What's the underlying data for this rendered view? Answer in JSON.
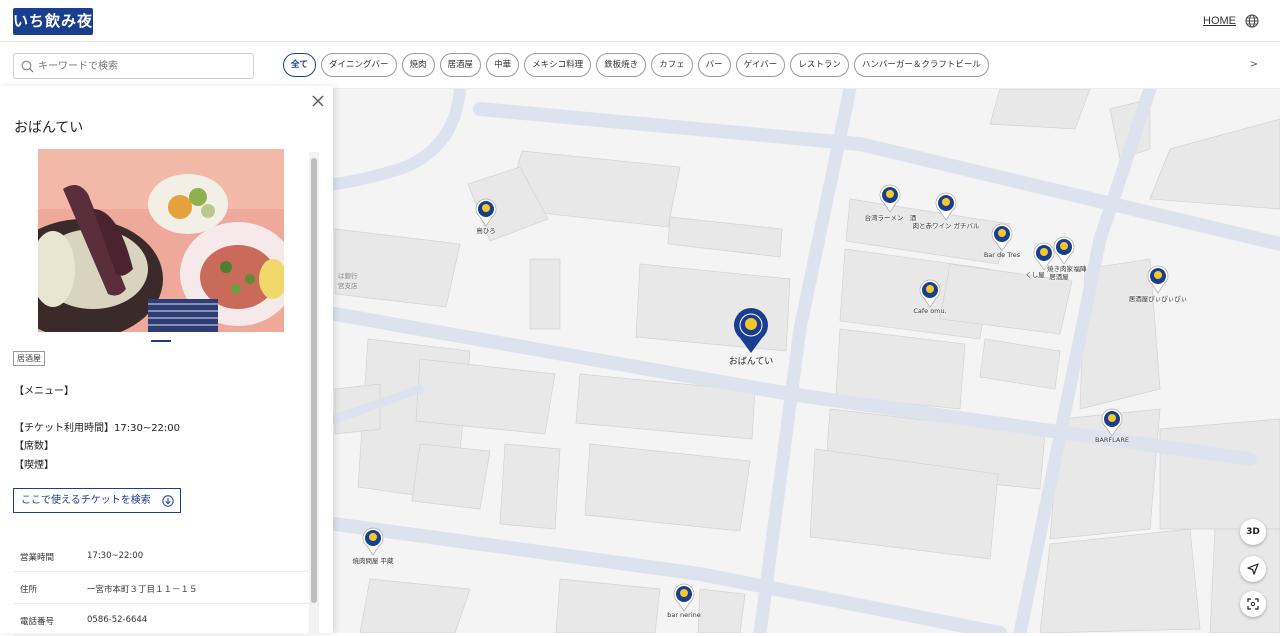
{
  "header": {
    "logo_text": "いち飲み夜",
    "home_label": "HOME",
    "globe_icon": "globe-icon"
  },
  "search": {
    "placeholder": "キーワードで検索"
  },
  "categories": [
    "全て",
    "ダイニングバー",
    "焼肉",
    "居酒屋",
    "中華",
    "メキシコ料理",
    "鉄板焼き",
    "カフェ",
    "バー",
    "ゲイバー",
    "レストラン",
    "ハンバーガー＆クラフトビール"
  ],
  "active_category": "全て",
  "next_arrow": ">",
  "panel": {
    "title": "おばんてい",
    "category_tag": "居酒屋",
    "menu_label": "【メニュー】",
    "ticket_time": "【チケット利用時間】17:30~22:00",
    "seats": "【席数】",
    "smoking": "【喫煙】",
    "ticket_button": "ここで使えるチケットを検索",
    "details": [
      {
        "key": "営業時間",
        "value": "17:30~22:00"
      },
      {
        "key": "住所",
        "value": "一宮市本町３丁目１１－１５"
      },
      {
        "key": "電話番号",
        "value": "0586-52-6644"
      }
    ]
  },
  "map": {
    "selected_label": "おばんてい",
    "pin_labels": [
      "鳥ひろ",
      "台湾ラーメン",
      "酒",
      "肉と赤ワイン ガチバル",
      "Bar de Tres",
      "くし屋",
      "焼き肉家",
      "居酒屋",
      "福陣",
      "居酒屋ぴぃぴぃぴぃ",
      "Cafe omu.",
      "BARFLARE",
      "焼肉問屋 平蔵",
      "bar nerine"
    ],
    "bank_text": "は銀行",
    "bank_text2": "宮支店",
    "controls": {
      "three_d": "3D"
    }
  },
  "colors": {
    "brand": "#1a3e8f",
    "accent": "#f5c82a"
  }
}
